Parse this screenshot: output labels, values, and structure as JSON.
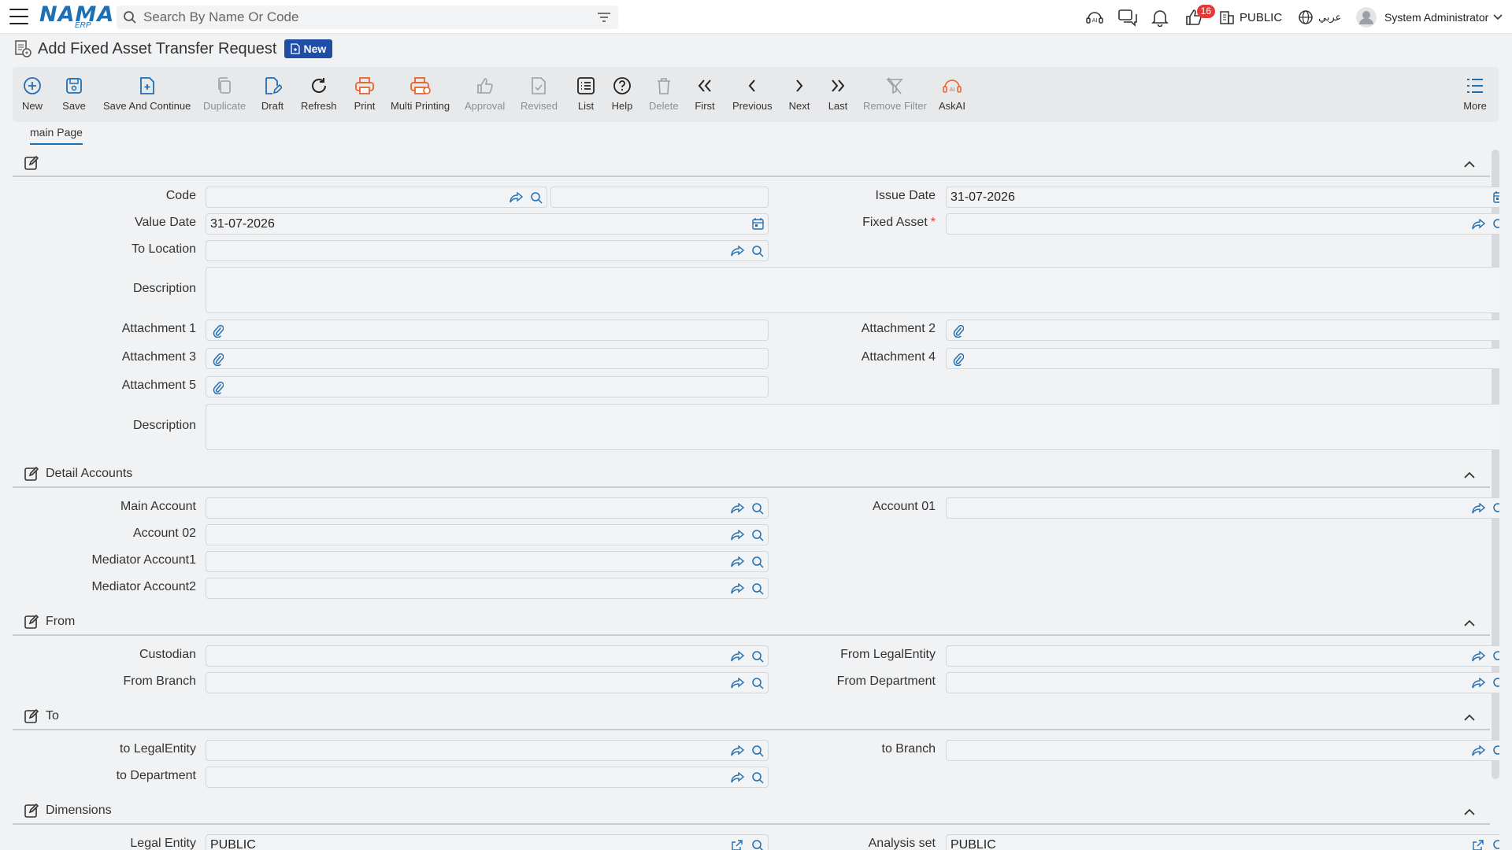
{
  "topbar": {
    "logo_text": "NAMA",
    "logo_sub": "ERP",
    "search_placeholder": "Search By Name Or Code",
    "notification_count": "16",
    "company": "PUBLIC",
    "language": "عربي",
    "user": "System Administrator"
  },
  "page": {
    "title": "Add Fixed Asset Transfer Request",
    "status": "New"
  },
  "toolbar": {
    "new": "New",
    "save": "Save",
    "save_continue": "Save And Continue",
    "duplicate": "Duplicate",
    "draft": "Draft",
    "refresh": "Refresh",
    "print": "Print",
    "multi_printing": "Multi Printing",
    "approval": "Approval",
    "revised": "Revised",
    "list": "List",
    "help": "Help",
    "delete": "Delete",
    "first": "First",
    "previous": "Previous",
    "next": "Next",
    "last": "Last",
    "remove_filter": "Remove Filter",
    "askai": "AskAI",
    "more": "More"
  },
  "tabs": [
    "main Page"
  ],
  "sections": {
    "detail_accounts": "Detail Accounts",
    "from": "From",
    "to": "To",
    "dimensions": "Dimensions"
  },
  "fields": {
    "code": {
      "label": "Code",
      "value": ""
    },
    "issue_date": {
      "label": "Issue Date",
      "value": "31-07-2026"
    },
    "value_date": {
      "label": "Value Date",
      "value": "31-07-2026"
    },
    "fixed_asset": {
      "label": "Fixed Asset",
      "required": "*",
      "value": ""
    },
    "to_location": {
      "label": "To Location",
      "value": ""
    },
    "description1": {
      "label": "Description"
    },
    "attachment1": {
      "label": "Attachment 1"
    },
    "attachment2": {
      "label": "Attachment 2"
    },
    "attachment3": {
      "label": "Attachment 3"
    },
    "attachment4": {
      "label": "Attachment 4"
    },
    "attachment5": {
      "label": "Attachment 5"
    },
    "description2": {
      "label": "Description"
    },
    "main_account": {
      "label": "Main Account",
      "value": ""
    },
    "account01": {
      "label": "Account 01",
      "value": ""
    },
    "account02": {
      "label": "Account 02",
      "value": ""
    },
    "mediator1": {
      "label": "Mediator Account1",
      "value": ""
    },
    "mediator2": {
      "label": "Mediator Account2",
      "value": ""
    },
    "custodian": {
      "label": "Custodian",
      "value": ""
    },
    "from_legal": {
      "label": "From LegalEntity",
      "value": ""
    },
    "from_branch": {
      "label": "From Branch",
      "value": ""
    },
    "from_department": {
      "label": "From Department",
      "value": ""
    },
    "to_legal": {
      "label": "to LegalEntity",
      "value": ""
    },
    "to_branch": {
      "label": "to Branch",
      "value": ""
    },
    "to_department": {
      "label": "to Department",
      "value": ""
    },
    "legal_entity": {
      "label": "Legal Entity",
      "value": "PUBLIC"
    },
    "analysis_set": {
      "label": "Analysis set",
      "value": "PUBLIC"
    }
  },
  "colors": {
    "accent": "#1f6fb5",
    "badge": "#1e4ea8",
    "print": "#e8632b",
    "required": "#e53935"
  }
}
